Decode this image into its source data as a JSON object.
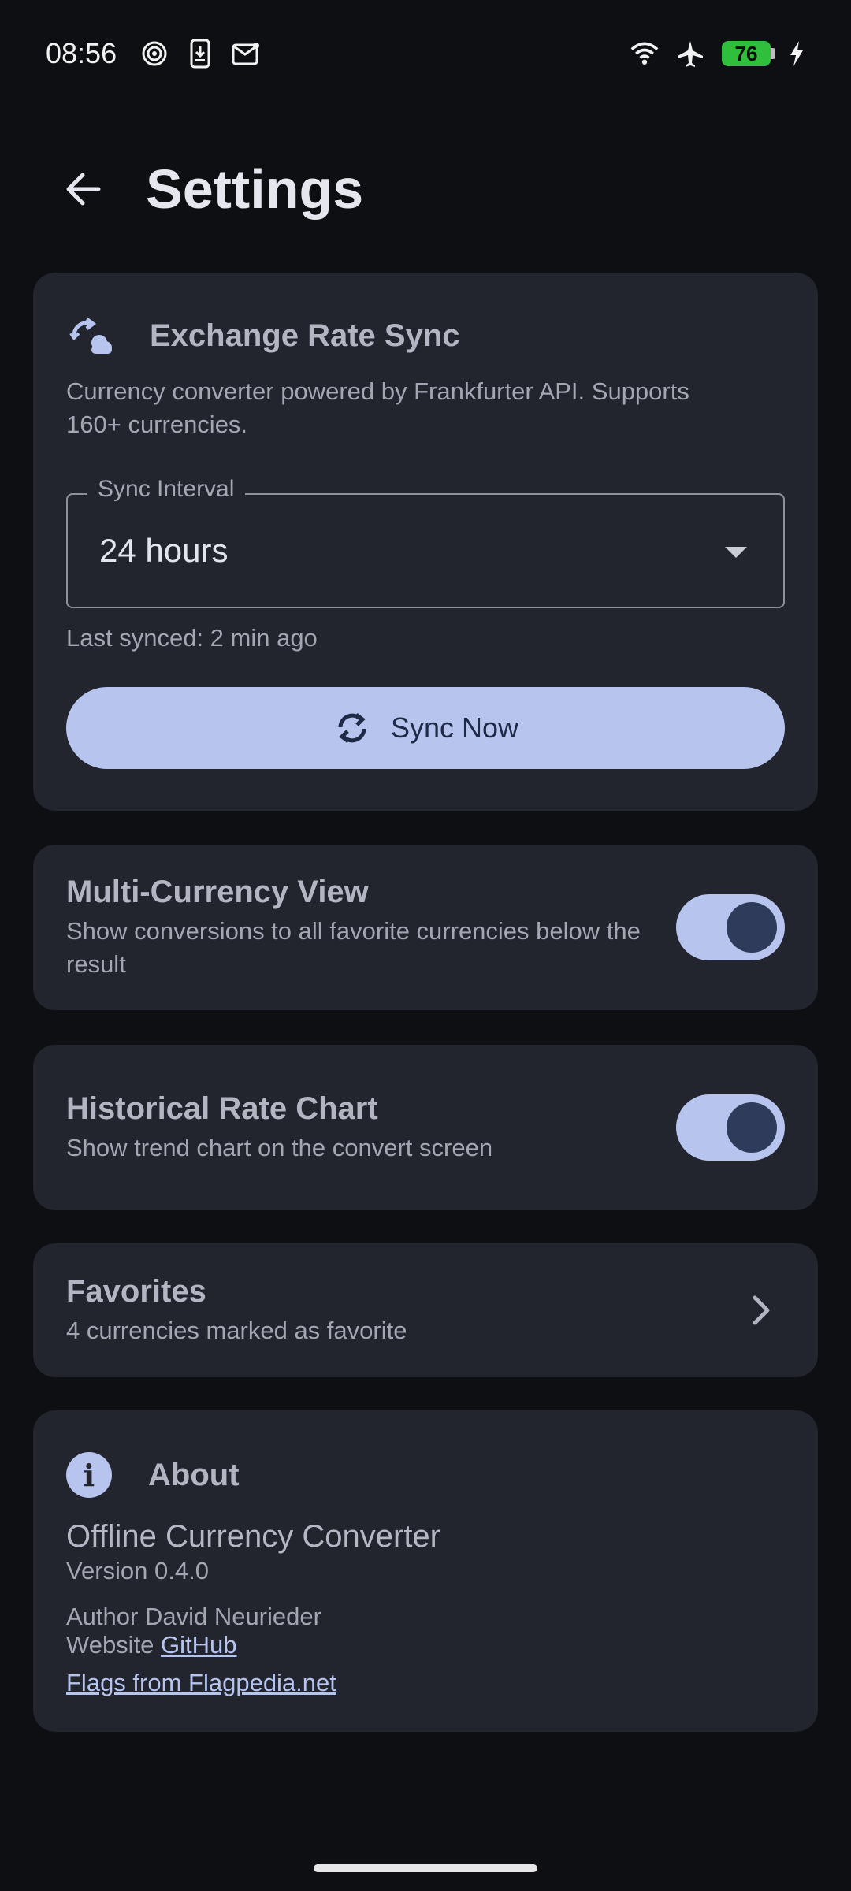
{
  "status_bar": {
    "time": "08:56",
    "battery_level": "76",
    "icons": [
      "target-icon",
      "phone-download-icon",
      "mail-icon",
      "wifi-icon",
      "airplane-icon",
      "battery-icon",
      "charging-icon"
    ]
  },
  "header": {
    "title": "Settings",
    "back_icon": "arrow-left-icon"
  },
  "sync_card": {
    "title": "Exchange Rate Sync",
    "description": "Currency converter powered by Frankfurter API. Supports 160+ currencies.",
    "interval_label": "Sync Interval",
    "interval_value": "24 hours",
    "last_synced": "Last synced: 2 min ago",
    "sync_button": "Sync Now"
  },
  "multi_currency": {
    "title": "Multi-Currency View",
    "subtitle": "Show conversions to all favorite currencies below the result",
    "enabled": true
  },
  "historical_chart": {
    "title": "Historical Rate Chart",
    "subtitle": "Show trend chart on the convert screen",
    "enabled": true
  },
  "favorites": {
    "title": "Favorites",
    "subtitle": "4 currencies marked as favorite"
  },
  "about": {
    "title": "About",
    "app_name": "Offline Currency Converter",
    "version": "Version 0.4.0",
    "author": "Author David Neurieder",
    "website_prefix": "Website",
    "website_link": "GitHub",
    "flags_link": "Flags from Flagpedia.net"
  },
  "colors": {
    "background": "#0e0f13",
    "card": "#22242e",
    "accent": "#b6c4ee",
    "battery": "#2fbf3c"
  }
}
